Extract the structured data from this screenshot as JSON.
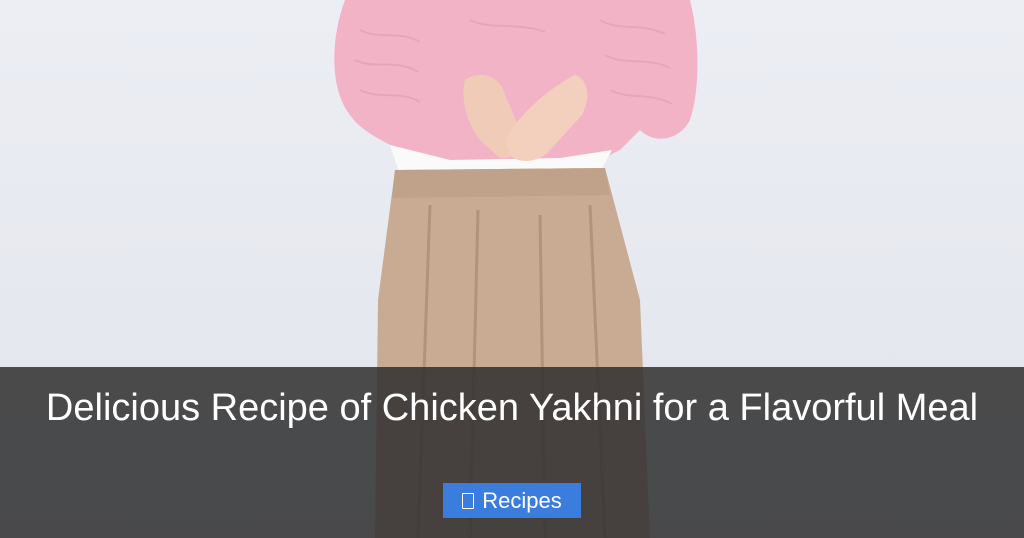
{
  "post": {
    "title": "Delicious Recipe of Chicken Yakhni for a Flavorful Meal",
    "category": {
      "label": "Recipes",
      "icon": "folder-icon"
    }
  },
  "colors": {
    "overlay": "#303030",
    "badge": "#3b7ddd",
    "text": "#ffffff",
    "sweater": "#f2b2c6",
    "skirt": "#c9ab93",
    "background": "#e9ebf2"
  }
}
